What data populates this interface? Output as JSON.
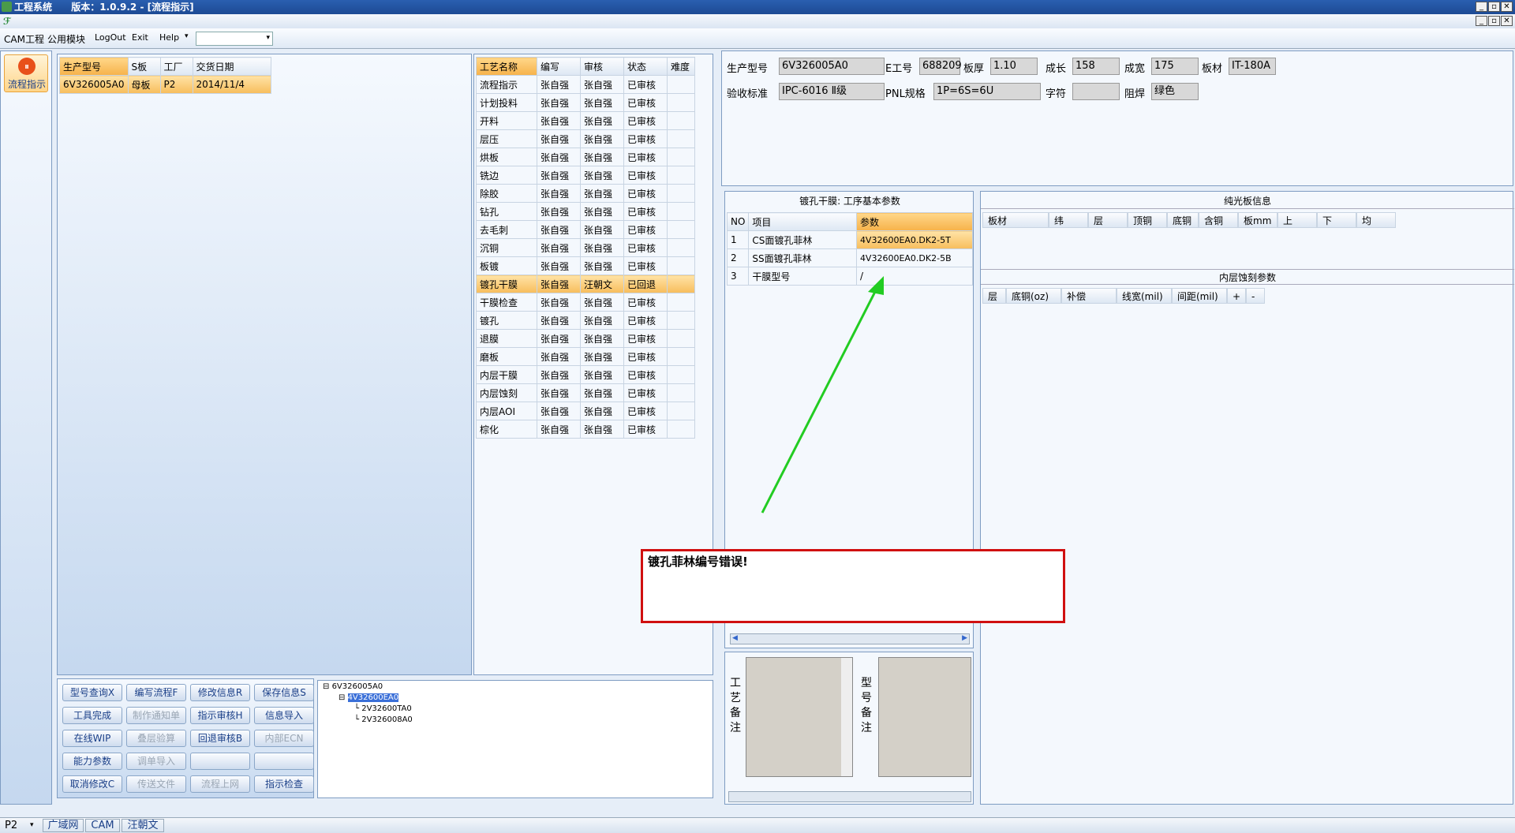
{
  "window": {
    "title": "工程系统",
    "version_text": "版本：1.0.9.2 - [流程指示]"
  },
  "menu": {
    "items": [
      "CAM工程",
      "公用模块",
      "LogOut",
      "Exit",
      "Help"
    ]
  },
  "sidebar": {
    "label": "流程指示"
  },
  "orders": {
    "headers": [
      "生产型号",
      "S板",
      "工厂",
      "交货日期"
    ],
    "rows": [
      [
        "6V326005A0",
        "母板",
        "P2",
        "2014/11/4"
      ]
    ]
  },
  "process": {
    "headers": [
      "工艺名称",
      "编写",
      "审核",
      "状态",
      "难度"
    ],
    "rows": [
      [
        "流程指示",
        "张自强",
        "张自强",
        "已审核",
        ""
      ],
      [
        "计划投料",
        "张自强",
        "张自强",
        "已审核",
        ""
      ],
      [
        "开料",
        "张自强",
        "张自强",
        "已审核",
        ""
      ],
      [
        "层压",
        "张自强",
        "张自强",
        "已审核",
        ""
      ],
      [
        "烘板",
        "张自强",
        "张自强",
        "已审核",
        ""
      ],
      [
        "铣边",
        "张自强",
        "张自强",
        "已审核",
        ""
      ],
      [
        "除胶",
        "张自强",
        "张自强",
        "已审核",
        ""
      ],
      [
        "钻孔",
        "张自强",
        "张自强",
        "已审核",
        ""
      ],
      [
        "去毛刺",
        "张自强",
        "张自强",
        "已审核",
        ""
      ],
      [
        "沉铜",
        "张自强",
        "张自强",
        "已审核",
        ""
      ],
      [
        "板镀",
        "张自强",
        "张自强",
        "已审核",
        ""
      ],
      [
        "镀孔干膜",
        "张自强",
        "汪朝文",
        "已回退",
        ""
      ],
      [
        "干膜检查",
        "张自强",
        "张自强",
        "已审核",
        ""
      ],
      [
        "镀孔",
        "张自强",
        "张自强",
        "已审核",
        ""
      ],
      [
        "退膜",
        "张自强",
        "张自强",
        "已审核",
        ""
      ],
      [
        "磨板",
        "张自强",
        "张自强",
        "已审核",
        ""
      ],
      [
        "内层干膜",
        "张自强",
        "张自强",
        "已审核",
        ""
      ],
      [
        "内层蚀刻",
        "张自强",
        "张自强",
        "已审核",
        ""
      ],
      [
        "内层AOI",
        "张自强",
        "张自强",
        "已审核",
        ""
      ],
      [
        "棕化",
        "张自强",
        "张自强",
        "已审核",
        ""
      ]
    ],
    "selected_index": 11
  },
  "buttons": [
    [
      "型号查询X",
      "编写流程F",
      "修改信息R",
      "保存信息S"
    ],
    [
      "工具完成",
      "制作通知单",
      "指示审核H",
      "信息导入"
    ],
    [
      "在线WIP",
      "叠层验算",
      "回退审核B",
      "内部ECN"
    ],
    [
      "能力参数",
      "调单导入",
      "",
      ""
    ],
    [
      "取消修改C",
      "传送文件",
      "流程上网",
      "指示检查"
    ]
  ],
  "tree": {
    "root": "6V326005A0",
    "child": "4V32600EA0",
    "leaves": [
      "2V32600TA0",
      "2V326008A0"
    ]
  },
  "info": {
    "row1": [
      {
        "label": "生产型号",
        "value": "6V326005A0"
      },
      {
        "label": "E工号",
        "value": "688209"
      },
      {
        "label": "板厚",
        "value": "1.10"
      },
      {
        "label": "成长",
        "value": "158"
      },
      {
        "label": "成宽",
        "value": "175"
      },
      {
        "label": "板材",
        "value": "IT-180A"
      }
    ],
    "row2": [
      {
        "label": "验收标准",
        "value": "IPC-6016 Ⅱ级"
      },
      {
        "label": "PNL规格",
        "value": "1P=6S=6U"
      },
      {
        "label": "字符",
        "value": ""
      },
      {
        "label": "阻焊",
        "value": "绿色"
      }
    ]
  },
  "params": {
    "title": "镀孔干膜: 工序基本参数",
    "headers": [
      "NO",
      "项目",
      "参数"
    ],
    "rows": [
      [
        "1",
        "CS面镀孔菲林",
        "4V32600EA0.DK2-5T"
      ],
      [
        "2",
        "SS面镀孔菲林",
        "4V32600EA0.DK2-5B"
      ],
      [
        "3",
        "干膜型号",
        "/"
      ]
    ]
  },
  "bare_board": {
    "title": "纯光板信息",
    "headers": [
      "板材",
      "纬",
      "层",
      "顶铜",
      "底铜",
      "含铜",
      "板mm",
      "上",
      "下",
      "均"
    ]
  },
  "inner_etch": {
    "title": "内层蚀刻参数",
    "headers": [
      "层",
      "底铜(oz)",
      "补偿",
      "线宽(mil)",
      "间距(mil)",
      "+",
      "-"
    ]
  },
  "remarks": {
    "process_label": "工艺备注",
    "model_label": "型号备注"
  },
  "annotation": {
    "text": "镀孔菲林编号错误!",
    "arrow_color": "#22cc22",
    "box_color": "#d01010"
  },
  "statusbar": {
    "combo": "P2",
    "items": [
      "广域网",
      "CAM",
      "汪朝文"
    ]
  }
}
